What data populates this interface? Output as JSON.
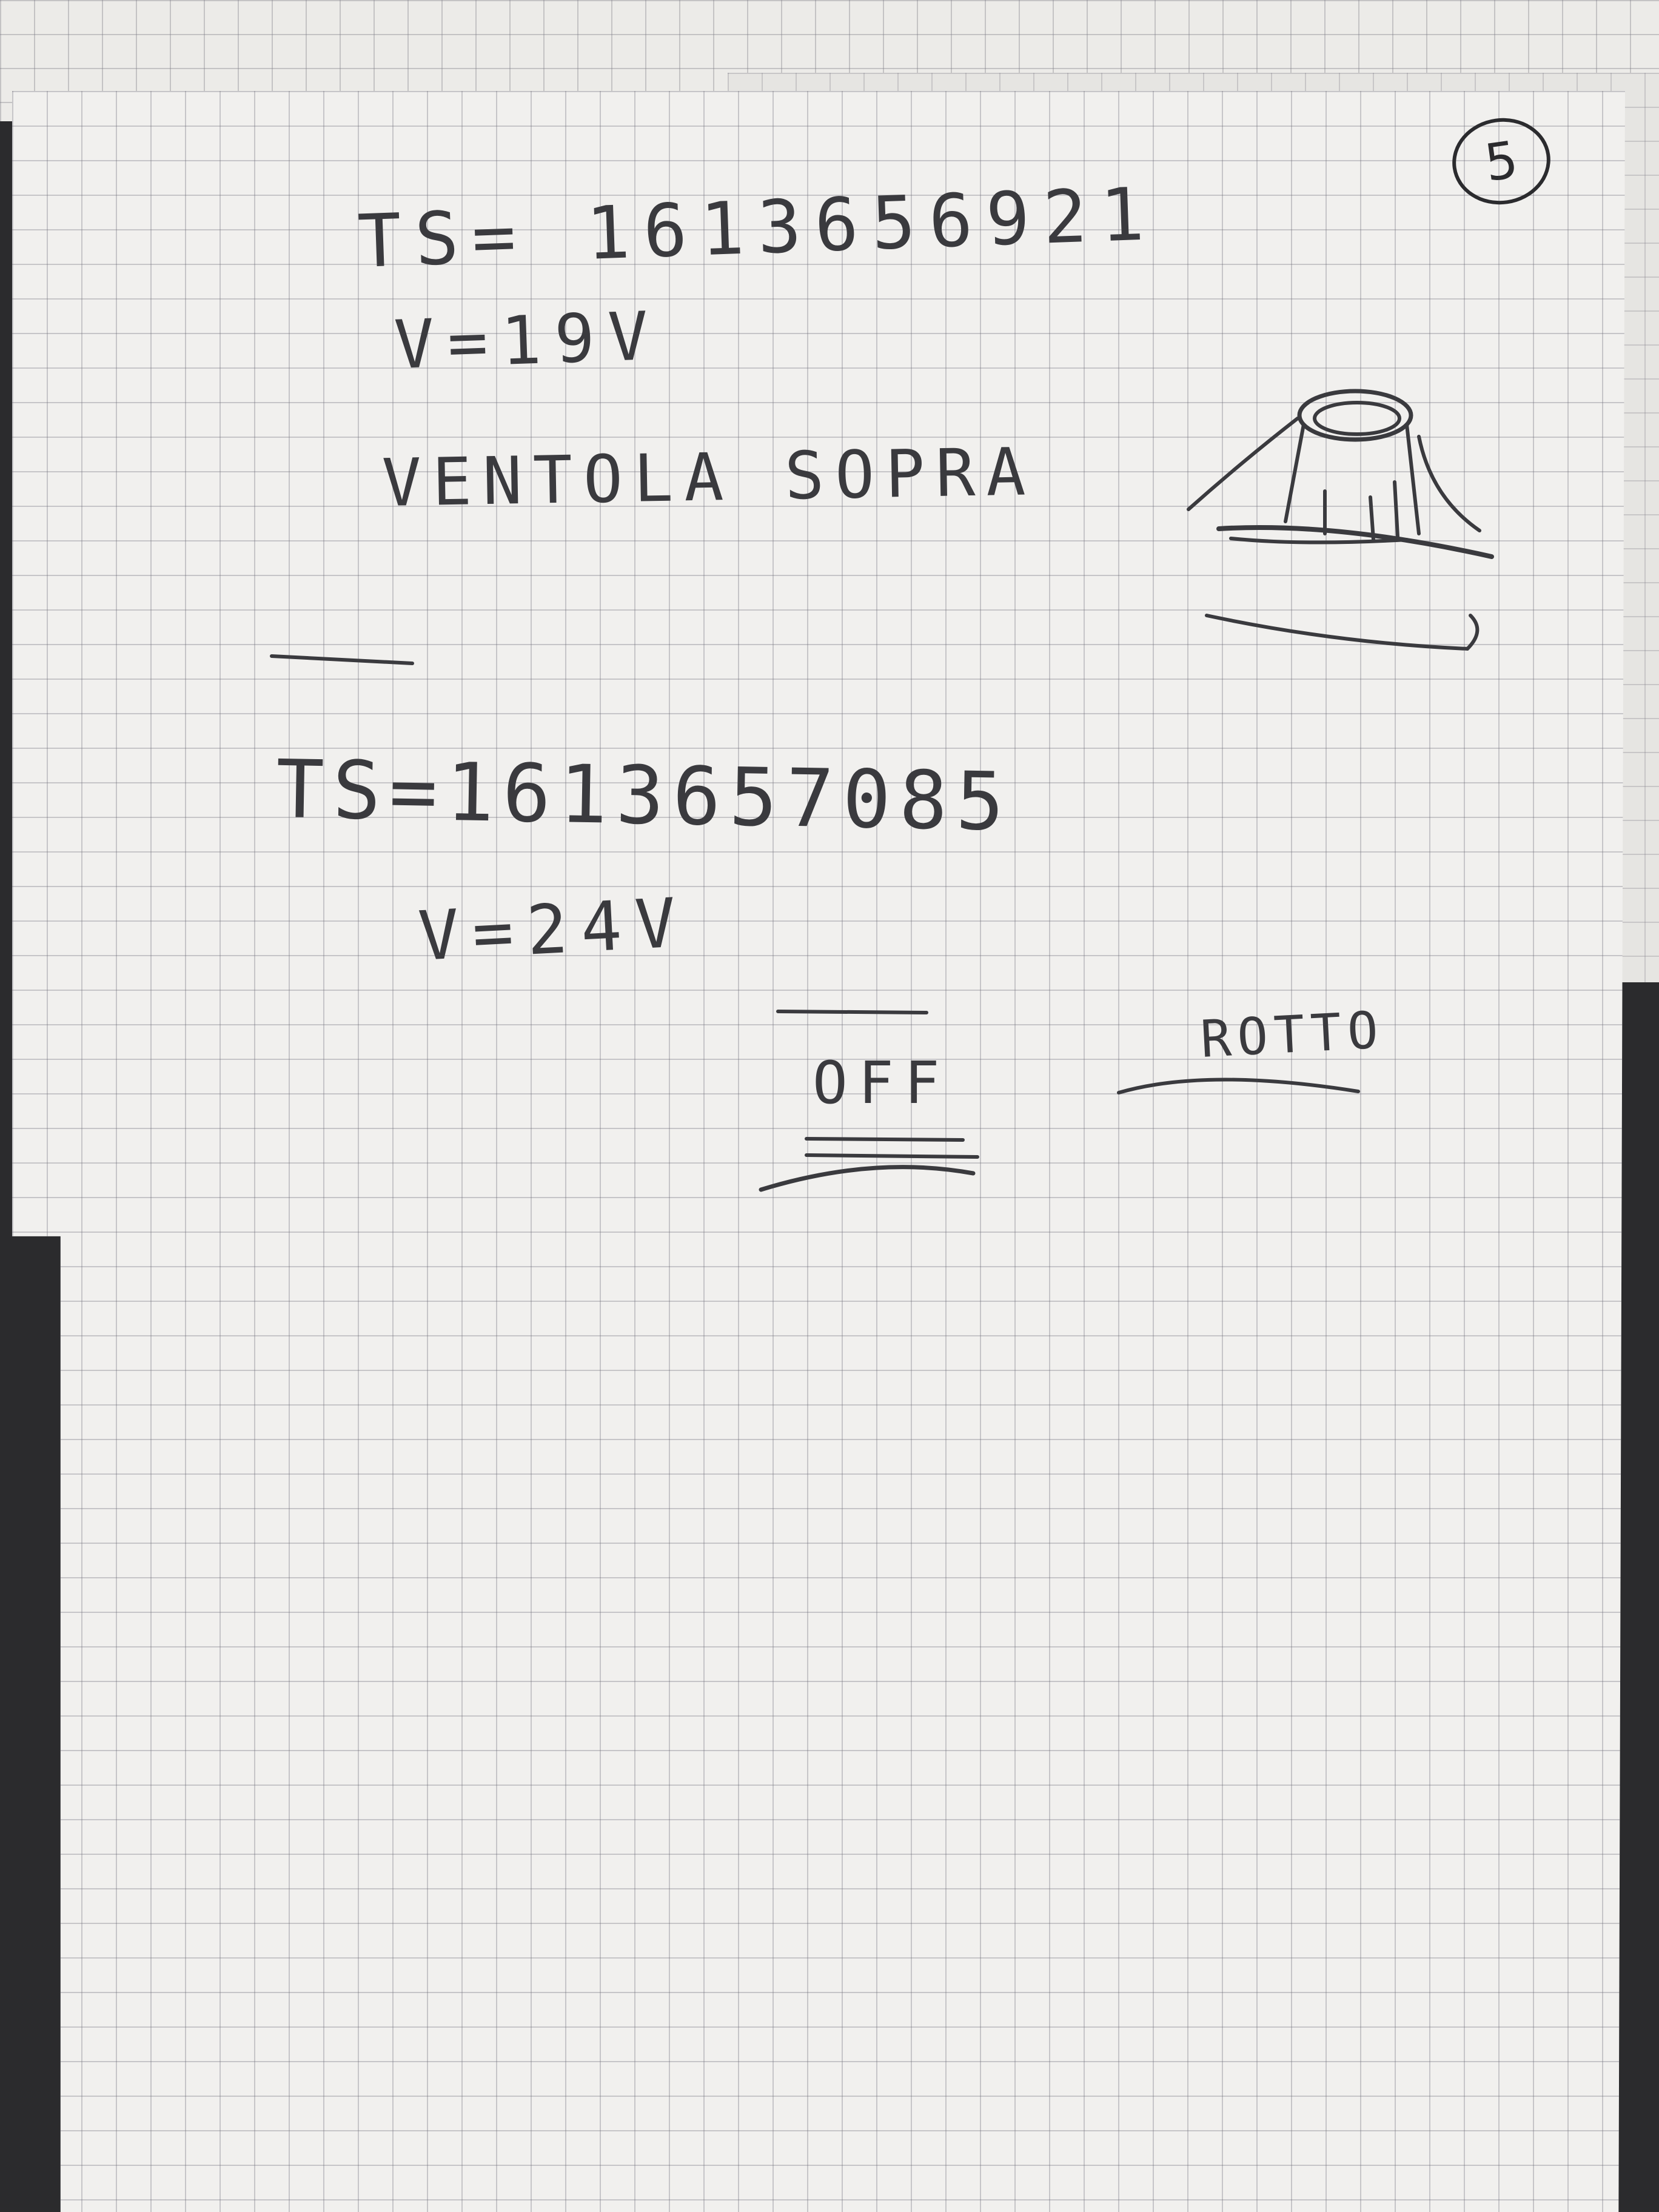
{
  "page": {
    "number": "5"
  },
  "notes": {
    "line1": "TS= 1613656921",
    "line2": "V=19V",
    "line3": "VENTOLA SOPRA",
    "line4": "TS=1613657085",
    "line5": "V=24V"
  },
  "labels": {
    "off": "OFF",
    "rotto": "ROTTO"
  },
  "colors": {
    "paper": "#f1f0ee",
    "grid": "#8c8c96",
    "ink": "#3a3a3e",
    "background": "#2b2b2d"
  },
  "sketch": {
    "icon": "fan-sketch-icon"
  }
}
